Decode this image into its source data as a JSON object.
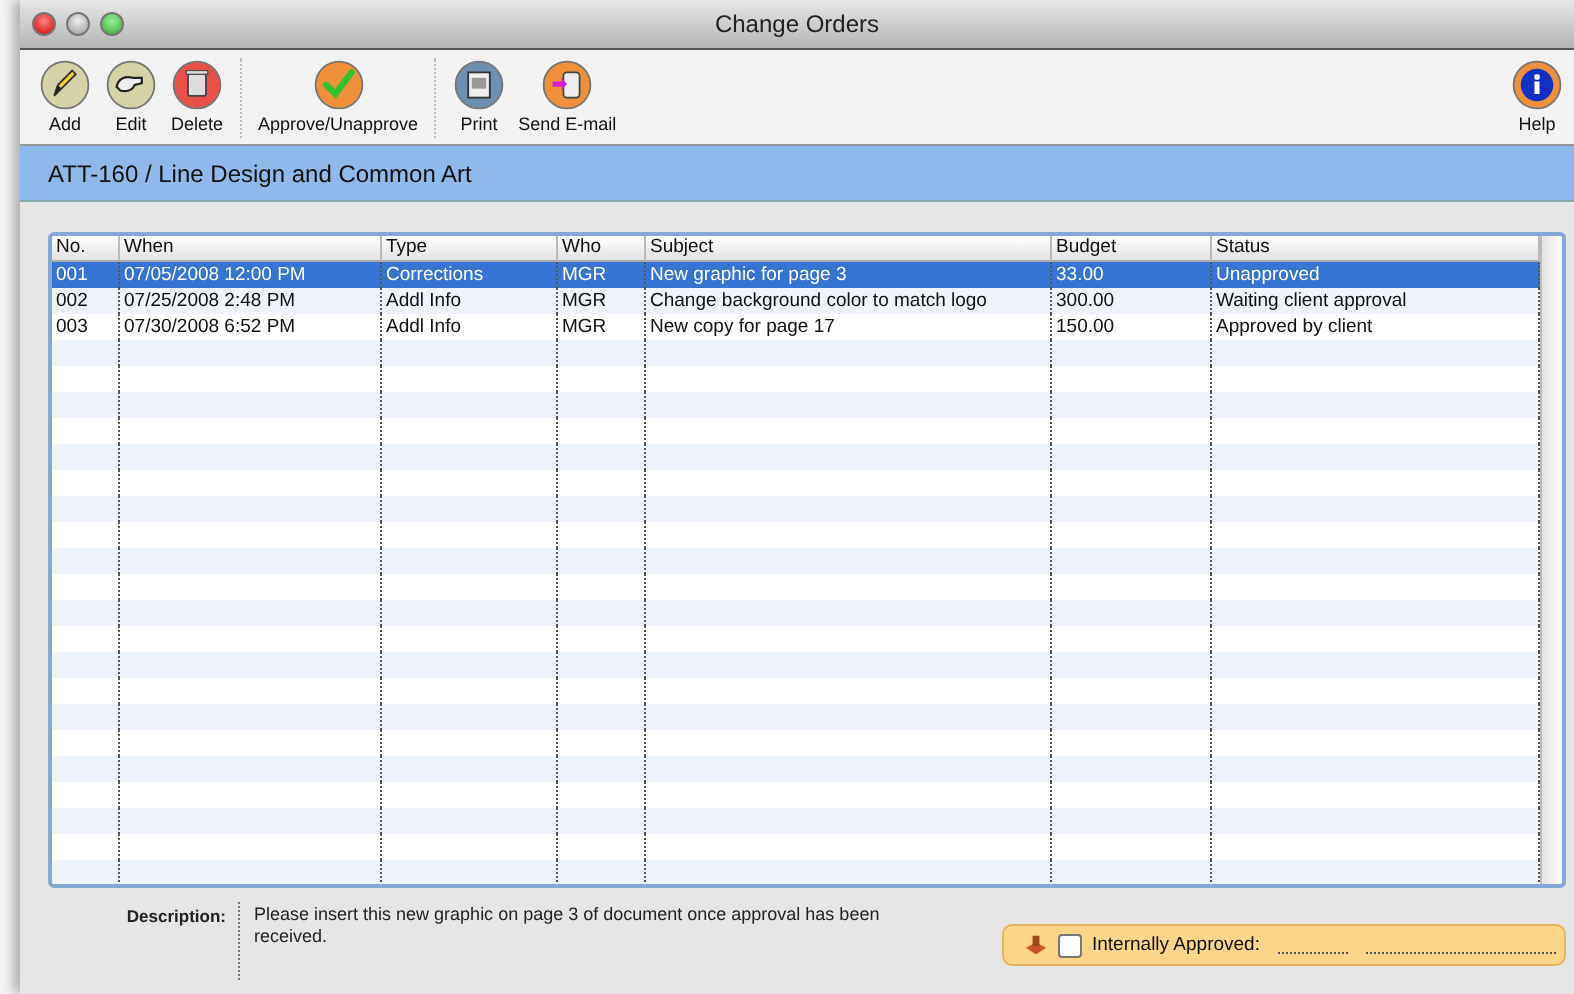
{
  "window": {
    "title": "Change Orders"
  },
  "toolbar": {
    "groups": [
      [
        {
          "label": "Add"
        },
        {
          "label": "Edit"
        },
        {
          "label": "Delete"
        }
      ],
      [
        {
          "label": "Approve/Unapprove"
        }
      ],
      [
        {
          "label": "Print"
        },
        {
          "label": "Send E-mail"
        }
      ]
    ],
    "help": {
      "label": "Help"
    }
  },
  "header": {
    "title": "ATT-160 / Line Design and Common Art"
  },
  "table": {
    "columns": [
      "No.",
      "When",
      "Type",
      "Who",
      "Subject",
      "Budget",
      "Status"
    ],
    "rows": [
      {
        "selected": true,
        "cells": [
          "001",
          "07/05/2008  12:00 PM",
          "Corrections",
          "MGR",
          "New graphic for page 3",
          "33.00",
          "Unapproved"
        ]
      },
      {
        "selected": false,
        "cells": [
          "002",
          "07/25/2008  2:48 PM",
          "Addl Info",
          "MGR",
          "Change background color to match logo",
          "300.00",
          "Waiting client approval"
        ]
      },
      {
        "selected": false,
        "cells": [
          "003",
          "07/30/2008  6:52 PM",
          "Addl Info",
          "MGR",
          "New copy for page 17",
          "150.00",
          "Approved by client"
        ]
      }
    ]
  },
  "description": {
    "label": "Description:",
    "text": "Please insert this new graphic on page 3 of document once approval has been received."
  },
  "approval": {
    "label": "Internally Approved:",
    "checked": false
  }
}
